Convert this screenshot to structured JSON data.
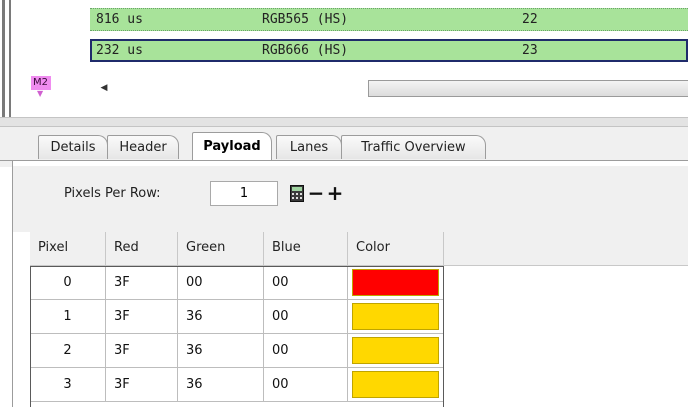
{
  "trace": {
    "rows": [
      {
        "time": "816 us",
        "format": "RGB565 (HS)",
        "number": "22"
      },
      {
        "time": "232 us",
        "format": "RGB666 (HS)",
        "number": "23"
      }
    ],
    "marker": "M2"
  },
  "tabs": [
    {
      "label": "Details"
    },
    {
      "label": "Header"
    },
    {
      "label": "Payload"
    },
    {
      "label": "Lanes"
    },
    {
      "label": "Traffic Overview"
    }
  ],
  "active_tab": "Payload",
  "payload": {
    "pixels_per_row_label": "Pixels Per Row:",
    "pixels_per_row_value": "1",
    "minus_label": "−",
    "plus_label": "+",
    "columns": [
      "Pixel",
      "Red",
      "Green",
      "Blue",
      "Color"
    ],
    "rows": [
      {
        "pixel": "0",
        "red": "3F",
        "green": "00",
        "blue": "00",
        "color": "#ff0000"
      },
      {
        "pixel": "1",
        "red": "3F",
        "green": "36",
        "blue": "00",
        "color": "#ffd800"
      },
      {
        "pixel": "2",
        "red": "3F",
        "green": "36",
        "blue": "00",
        "color": "#ffd800"
      },
      {
        "pixel": "3",
        "red": "3F",
        "green": "36",
        "blue": "00",
        "color": "#ffd800"
      }
    ]
  },
  "colors": {
    "trace_row": "#a8e39a",
    "selected_row_border": "#1f2b6b",
    "marker": "#f08cf0"
  },
  "icons": {
    "calculator": "calculator-icon",
    "scroll_left": "scroll-left-arrow-icon",
    "marker_arrow": "marker-arrow-icon"
  }
}
